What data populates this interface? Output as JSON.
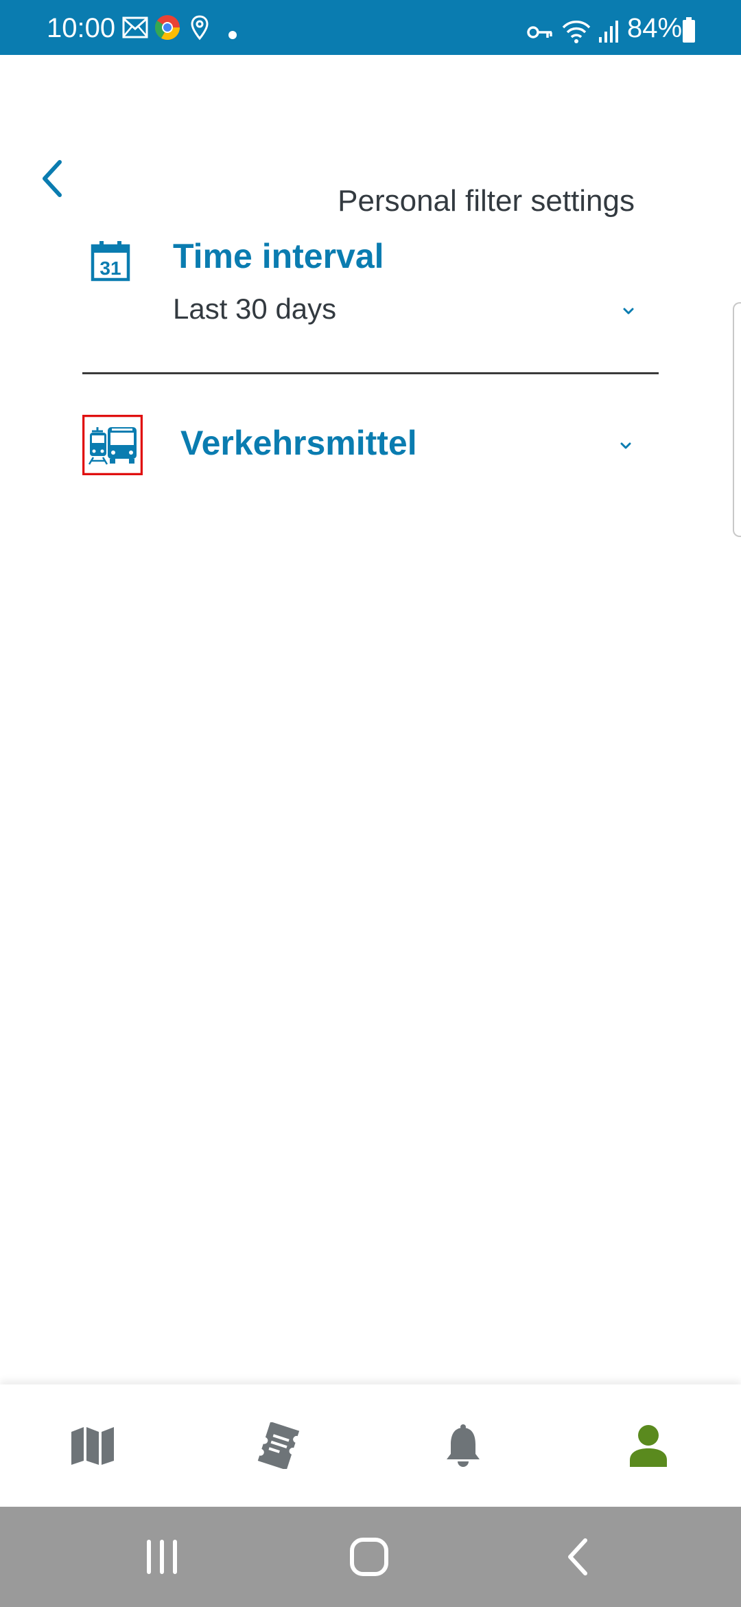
{
  "status_bar": {
    "time": "10:00",
    "battery": "84%",
    "icons": [
      "mail-icon",
      "chrome-icon",
      "location-icon",
      "notification-dot-icon",
      "vpn-key-icon",
      "wifi-icon",
      "signal-icon",
      "battery-icon"
    ],
    "background_color": "#0a7cb0"
  },
  "header": {
    "title": "Personal filter settings",
    "back_icon": "chevron-left-icon"
  },
  "filters": [
    {
      "icon": "calendar-icon",
      "calendar_day": "31",
      "title": "Time interval",
      "value": "Last 30 days",
      "expand_icon": "chevron-down-icon"
    },
    {
      "icon": "tram-bus-icon",
      "title": "Verkehrsmittel",
      "expand_icon": "chevron-down-icon"
    }
  ],
  "bottom_nav": {
    "items": [
      {
        "icon": "map-icon",
        "active": false
      },
      {
        "icon": "ticket-icon",
        "active": false
      },
      {
        "icon": "bell-icon",
        "active": false
      },
      {
        "icon": "person-icon",
        "active": true
      }
    ],
    "active_color": "#5a8a1e",
    "inactive_color": "#6e7478"
  },
  "system_nav": {
    "buttons": [
      "recent-apps-icon",
      "home-icon",
      "system-back-icon"
    ]
  },
  "colors": {
    "accent": "#0a7cb0",
    "text": "#333a40",
    "highlight_box": "#e01010"
  }
}
